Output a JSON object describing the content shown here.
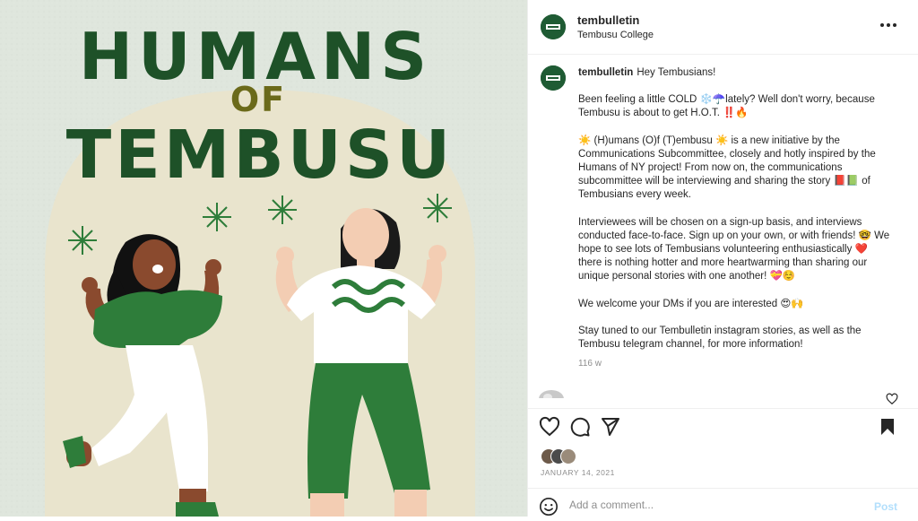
{
  "post": {
    "artwork_title": [
      "HUMANS",
      "OF",
      "TEMBUSU"
    ],
    "colors": {
      "background": "#dfe6dd",
      "arch": "#e9e4cd",
      "title": "#1e5128",
      "green": "#2e7d3a",
      "skin_left": "#8a4a2e",
      "skin_right": "#f3cdb3"
    }
  },
  "header": {
    "username": "tembulletin",
    "subtitle": "Tembusu College",
    "avatar_text": "TEMBUSU COLLEGE"
  },
  "caption": {
    "username": "tembulletin",
    "paragraphs": [
      "Hey Tembusians!",
      "Been feeling a little COLD ❄️☂️lately? Well don't worry, because Tembusu is about to get H.O.T. ‼️🔥",
      "☀️ (H)umans (O)f (T)embusu ☀️ is a new initiative by the Communications Subcommittee, closely and hotly inspired by the Humans of NY project! From now on, the communications subcommittee will be interviewing and sharing the story 📕📗 of Tembusians every week.",
      "Interviewees will be chosen on a sign-up basis, and interviews conducted face-to-face. Sign up on your own, or with friends! 🤓 We hope to see lots of Tembusians volunteering enthusiastically ❤️ there is nothing hotter and more heartwarming than sharing our unique personal stories with one another! 💝☺️",
      "We welcome your DMs if you are interested 😍🙌",
      "Stay tuned to our Tembulletin instagram stories, as well as the Tembusu telegram channel, for more information!"
    ],
    "time_ago": "116 w"
  },
  "actions": {
    "like_icon": "heart-outline-icon",
    "comment_icon": "comment-bubble-icon",
    "share_icon": "paper-plane-icon",
    "save_icon": "bookmark-filled-icon"
  },
  "date": "JANUARY 14, 2021",
  "comment_box": {
    "placeholder": "Add a comment...",
    "post_label": "Post",
    "emoji_icon": "smiley-icon"
  }
}
